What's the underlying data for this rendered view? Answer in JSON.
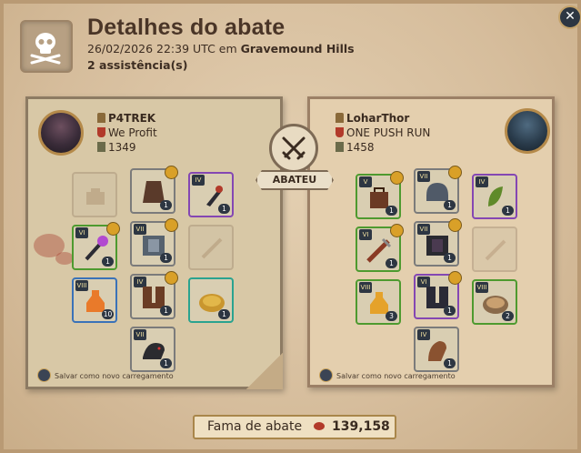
{
  "header": {
    "title": "Detalhes do abate",
    "datetime": "26/02/2026 22:39 UTC em",
    "location": "Gravemound Hills",
    "assists": "2 assistência(s)"
  },
  "killer": {
    "name": "P4TREK",
    "guild": "We Profit",
    "item_power": "1349",
    "save_label": "Salvar como novo carregamento",
    "items": [
      {
        "id": "bag",
        "tier": "",
        "qty": "",
        "ghost": true,
        "color": "gray"
      },
      {
        "id": "cape",
        "tier": "",
        "qty": "1",
        "ench": true,
        "color": "gray"
      },
      {
        "id": "offhand",
        "tier": "IV",
        "qty": "1",
        "color": "purple"
      },
      {
        "id": "weapon",
        "tier": "VI",
        "qty": "1",
        "ench": true,
        "color": "green"
      },
      {
        "id": "armor",
        "tier": "VII",
        "qty": "1",
        "ench": true,
        "color": "gray"
      },
      {
        "id": "empty",
        "tier": "",
        "qty": "",
        "ghost": true,
        "color": "gray"
      },
      {
        "id": "potion",
        "tier": "VIII",
        "qty": "10",
        "color": "blue"
      },
      {
        "id": "boots",
        "tier": "IV",
        "qty": "1",
        "ench": true,
        "color": "gray"
      },
      {
        "id": "food",
        "tier": "",
        "qty": "1",
        "color": "teal"
      },
      {
        "id": "mount",
        "tier": "VII",
        "qty": "1",
        "color": "gray"
      }
    ]
  },
  "victim": {
    "name": "LoharThor",
    "guild": "ONE PUSH RUN",
    "item_power": "1458",
    "save_label": "Salvar como novo carregamento",
    "items": [
      {
        "id": "bag",
        "tier": "V",
        "qty": "1",
        "ench": true,
        "color": "green"
      },
      {
        "id": "helmet",
        "tier": "VII",
        "qty": "1",
        "ench": true,
        "color": "gray"
      },
      {
        "id": "offhand",
        "tier": "IV",
        "qty": "1",
        "color": "purple"
      },
      {
        "id": "weapon",
        "tier": "VI",
        "qty": "1",
        "ench": true,
        "color": "green"
      },
      {
        "id": "armor",
        "tier": "VII",
        "qty": "1",
        "ench": true,
        "color": "gray"
      },
      {
        "id": "empty",
        "tier": "",
        "qty": "",
        "ghost": true,
        "color": "gray"
      },
      {
        "id": "potion",
        "tier": "VIII",
        "qty": "3",
        "color": "green"
      },
      {
        "id": "boots",
        "tier": "VI",
        "qty": "1",
        "ench": true,
        "color": "purple"
      },
      {
        "id": "food",
        "tier": "VIII",
        "qty": "2",
        "color": "green"
      },
      {
        "id": "mount",
        "tier": "IV",
        "qty": "1",
        "color": "gray"
      }
    ]
  },
  "center_label": "ABATEU",
  "footer": {
    "fame_label": "Fama de abate",
    "fame_value": "139,158"
  },
  "colors": {
    "background": "#d9c2a3",
    "accent_gold": "#c5a36b",
    "blood": "#b23a2a"
  }
}
